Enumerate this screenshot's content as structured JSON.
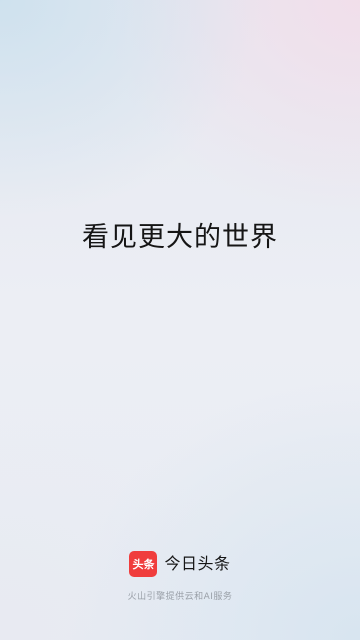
{
  "splash": {
    "slogan": "看见更大的世界",
    "brand": {
      "logo_text": "头条",
      "name": "今日头条",
      "logo_color": "#f03d3d"
    },
    "powered_by": "火山引擎提供云和AI服务"
  }
}
